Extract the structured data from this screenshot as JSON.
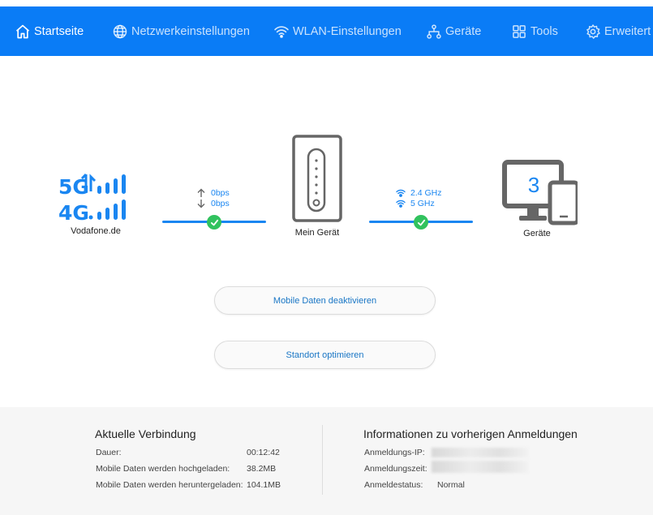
{
  "nav": {
    "items": [
      {
        "label": "Startseite",
        "icon": "home-icon"
      },
      {
        "label": "Netzwerkeinstellungen",
        "icon": "globe-icon"
      },
      {
        "label": "WLAN-Einstellungen",
        "icon": "wifi-icon"
      },
      {
        "label": "Geräte",
        "icon": "devices-tree-icon"
      },
      {
        "label": "Tools",
        "icon": "grid-icon"
      },
      {
        "label": "Erweitert",
        "icon": "gear-icon"
      }
    ],
    "active": "Startseite"
  },
  "topology": {
    "provider": {
      "logo_top": "5G",
      "logo_bottom": "4G",
      "name": "Vodafone.de"
    },
    "uplink": {
      "upload": "0bps",
      "download": "0bps"
    },
    "router": {
      "name": "Mein Gerät"
    },
    "wifi": {
      "band1": "2.4 GHz",
      "band2": "5 GHz"
    },
    "clients": {
      "count": "3",
      "label": "Geräte"
    }
  },
  "actions": {
    "mobile_data": "Mobile Daten deaktivieren",
    "optimize": "Standort optimieren"
  },
  "connection": {
    "title": "Aktuelle Verbindung",
    "rows": [
      {
        "label": "Dauer:",
        "value": "00:12:42"
      },
      {
        "label": "Mobile Daten werden hochgeladen:",
        "value": "38.2MB"
      },
      {
        "label": "Mobile Daten werden heruntergeladen:",
        "value": "104.1MB"
      }
    ]
  },
  "login": {
    "title": "Informationen zu vorherigen Anmeldungen",
    "rows": [
      {
        "label": "Anmeldungs-IP:",
        "value": ""
      },
      {
        "label": "Anmeldungszeit:",
        "value": ""
      },
      {
        "label": "Anmeldestatus:",
        "value": "Normal"
      }
    ]
  },
  "colors": {
    "nav_bg": "#0a7cf6",
    "accent": "#1a86f1",
    "ok": "#31c25e",
    "device_gray": "#666666",
    "panel_bg": "#f6f6f6"
  }
}
